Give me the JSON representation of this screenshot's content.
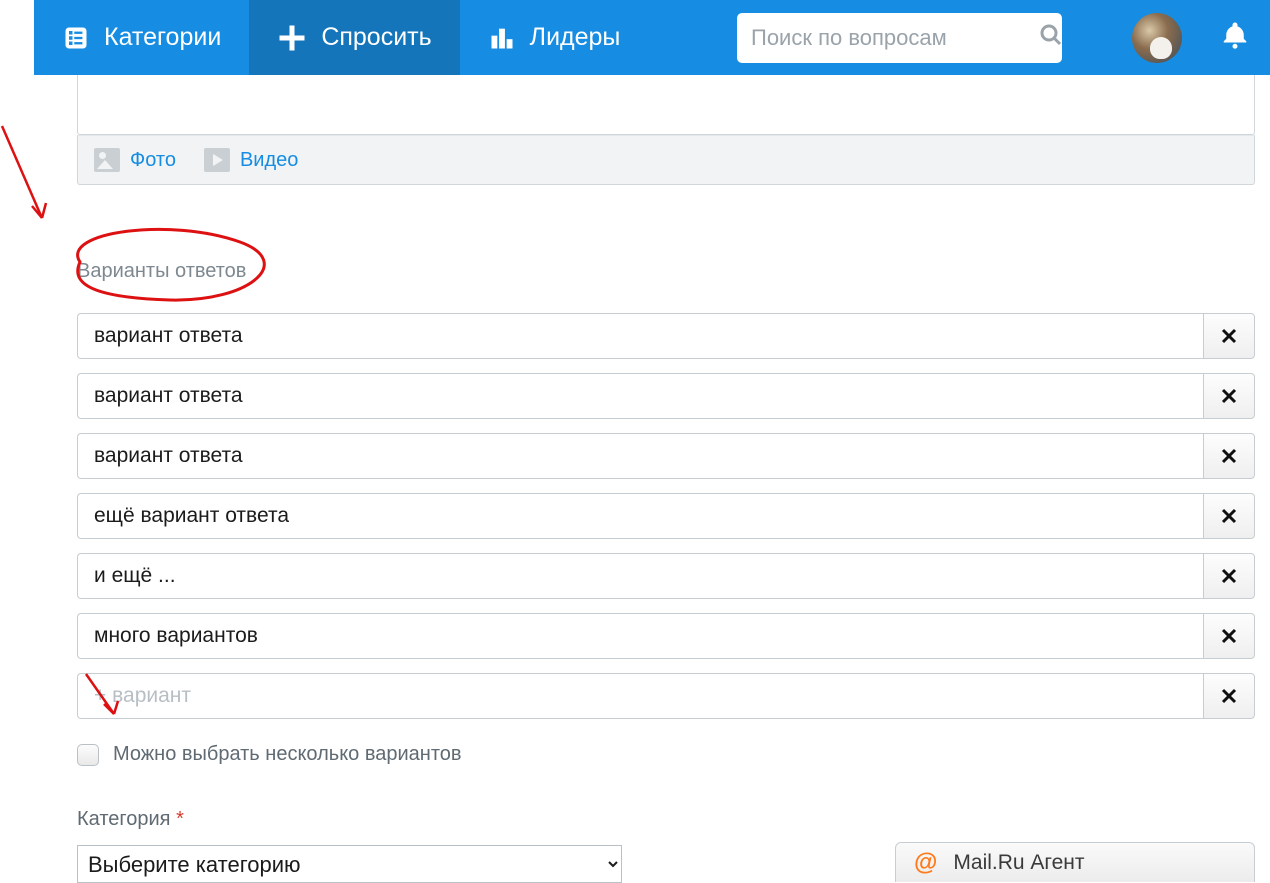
{
  "nav": {
    "categories": "Категории",
    "ask": "Спросить",
    "leaders": "Лидеры"
  },
  "search": {
    "placeholder": "Поиск по вопросам"
  },
  "media": {
    "photo": "Фото",
    "video": "Видео"
  },
  "section": {
    "answer_options_label": "Варианты ответов"
  },
  "options": [
    {
      "value": "вариант ответа"
    },
    {
      "value": "вариант ответа"
    },
    {
      "value": "вариант ответа"
    },
    {
      "value": "ещё вариант ответа"
    },
    {
      "value": "и ещё ..."
    },
    {
      "value": "много вариантов"
    },
    {
      "value": "",
      "placeholder": "+ вариант"
    }
  ],
  "multiselect_label": "Можно выбрать несколько вариантов",
  "category": {
    "label": "Категория",
    "required_mark": "*",
    "select_placeholder": "Выберите категорию"
  },
  "agent": {
    "label": "Mail.Ru Агент",
    "at": "@"
  }
}
